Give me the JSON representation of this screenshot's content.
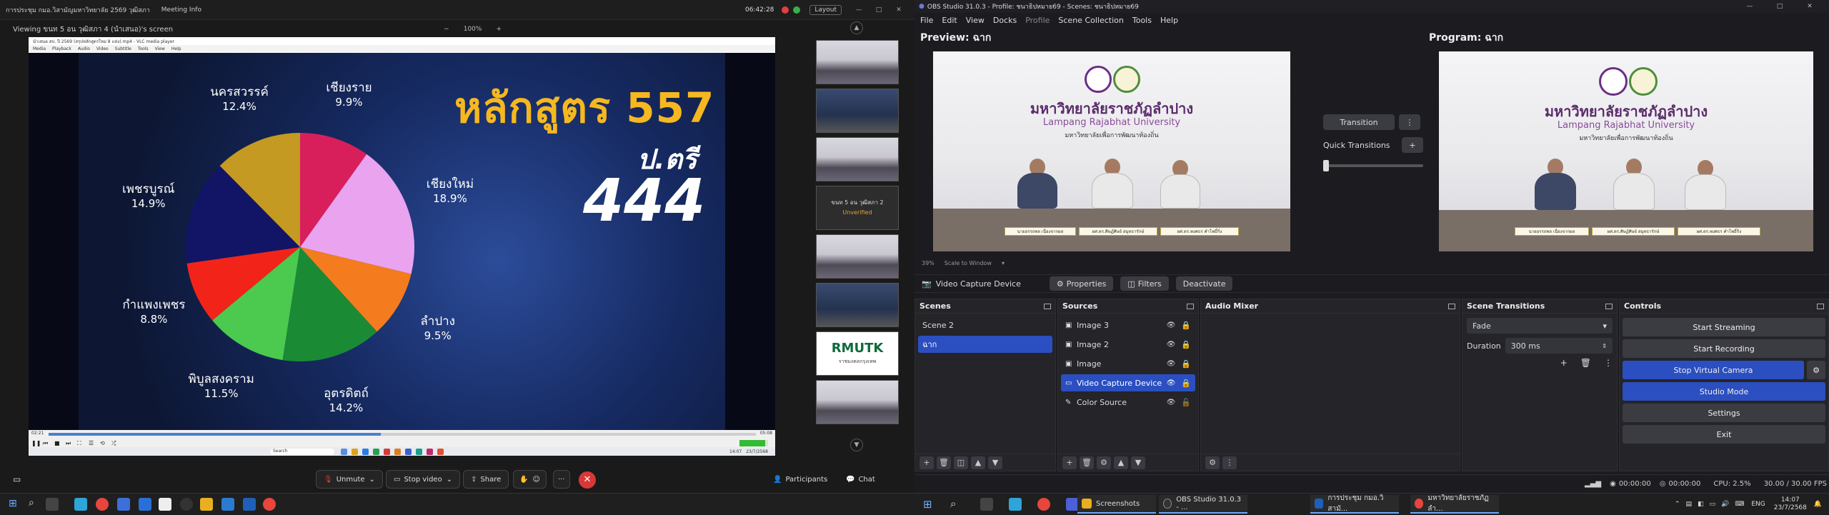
{
  "zoom": {
    "title_meeting": "การประชุม กมอ.วิสามัญมหาวิทยาลัย 2569 วุฒิสภา",
    "title_app": "Meeting Info",
    "clock": "06:42:28",
    "layout_label": "Layout",
    "viewing_label": "Viewing ขนท 5 อน วุฒิสภา 4 (นำเสนอ)'s screen",
    "zoom_minus": "−",
    "zoom_level": "100%",
    "zoom_plus": "+",
    "thumbnails": [
      {
        "kind": "room"
      },
      {
        "kind": "dark"
      },
      {
        "kind": "room"
      },
      {
        "kind": "text",
        "name": "ขนท 5 อน วุฒิสภา 2",
        "status": "Unverified"
      },
      {
        "kind": "room"
      },
      {
        "kind": "dark"
      },
      {
        "kind": "logo",
        "logo_text": "RMUTK",
        "logo_sub": "ราชมงคลกรุงเทพ"
      },
      {
        "kind": "room"
      }
    ],
    "bottom": {
      "unmute": "Unmute",
      "stop_video": "Stop video",
      "share": "Share",
      "more": "···",
      "participants": "Participants",
      "chat": "Chat"
    }
  },
  "vlc": {
    "title": "นำเสนอ สป. ปี 2569 (สรุปหลักสูตรใหม่ 8 แห่ง).mp4 - VLC media player",
    "menu": [
      "Media",
      "Playback",
      "Audio",
      "Video",
      "Subtitle",
      "Tools",
      "View",
      "Help"
    ],
    "time_left": "02:21",
    "time_right": "05:08",
    "progress": 0.47,
    "taskbar_search": "Search",
    "taskbar_time": "14:07",
    "taskbar_date": "23/7/2568"
  },
  "slide": {
    "course_label": "หลักสูตร 557",
    "degree_label": "ป.ตรี",
    "degree_count": "444"
  },
  "chart_data": {
    "type": "pie",
    "title": "",
    "slices": [
      {
        "label": "เชียงราย",
        "value": 9.9,
        "display": "9.9%",
        "color": "#d81f5c"
      },
      {
        "label": "เชียงใหม่",
        "value": 18.9,
        "display": "18.9%",
        "color": "#e9a3ef"
      },
      {
        "label": "ลำปาง",
        "value": 9.5,
        "display": "9.5%",
        "color": "#f47c1e"
      },
      {
        "label": "อุตรดิตถ์",
        "value": 14.2,
        "display": "14.2%",
        "color": "#1b8a35"
      },
      {
        "label": "พิบูลสงคราม",
        "value": 11.5,
        "display": "11.5%",
        "color": "#4cc94f"
      },
      {
        "label": "กำแพงเพชร",
        "value": 8.8,
        "display": "8.8%",
        "color": "#f2241a"
      },
      {
        "label": "เพชรบูรณ์",
        "value": 14.9,
        "display": "14.9%",
        "color": "#121566"
      },
      {
        "label": "นครสวรรค์",
        "value": 12.4,
        "display": "12.4%",
        "color": "#c59a22"
      }
    ]
  },
  "obs": {
    "title": "OBS Studio 31.0.3 - Profile: ชนาธิปหมาย69 - Scenes: ชนาธิปหมาย69",
    "menu": [
      "File",
      "Edit",
      "View",
      "Docks",
      "Profile",
      "Scene Collection",
      "Tools",
      "Help"
    ],
    "preview_label": "Preview: ฉาก",
    "program_label": "Program: ฉาก",
    "scene_thai": "มหาวิทยาลัยราชภัฏลำปาง",
    "scene_en": "Lampang Rajabhat University",
    "scene_tag": "มหาวิทยาลัยเพื่อการพัฒนาท้องถิ่น",
    "plates": [
      "นายอรรถพล เนื่องจากผล",
      "ผศ.ดร.ศิษฏ์ศิษย์ สมุทธารักษ์",
      "ผศ.ดร.พงศธร คำโพธิ์กิ่ง"
    ],
    "preview_zoom": "39%",
    "scale_mode": "Scale to Window",
    "transition_btn": "Transition",
    "quick_transitions": "Quick Transitions",
    "source_name": "Video Capture Device",
    "properties_btn": "Properties",
    "filters_btn": "Filters",
    "deactivate_btn": "Deactivate",
    "scenes_header": "Scenes",
    "scenes": [
      "Scene 2",
      "ฉาก"
    ],
    "sources_header": "Sources",
    "sources": [
      "Image 3",
      "Image 2",
      "Image",
      "Video Capture Device",
      "Color Source"
    ],
    "mixer_header": "Audio Mixer",
    "transitions_header": "Scene Transitions",
    "transition_value": "Fade",
    "duration_label": "Duration",
    "duration_value": "300 ms",
    "controls_header": "Controls",
    "controls": [
      "Start Streaming",
      "Start Recording",
      "Stop Virtual Camera",
      "Studio Mode",
      "Settings",
      "Exit"
    ],
    "status": {
      "stream_time": "00:00:00",
      "rec_time": "00:00:00",
      "cpu": "CPU: 2.5%",
      "fps": "30.00 / 30.00 FPS"
    }
  },
  "taskbar": {
    "tasks": [
      "Screenshots",
      "OBS Studio 31.0.3 - ...",
      "การประชุม กมอ.วิสามั...",
      "มหาวิทยาลัยราชภัฏลำ..."
    ],
    "lang": "ENG",
    "time": "14:07",
    "date": "23/7/2568"
  }
}
